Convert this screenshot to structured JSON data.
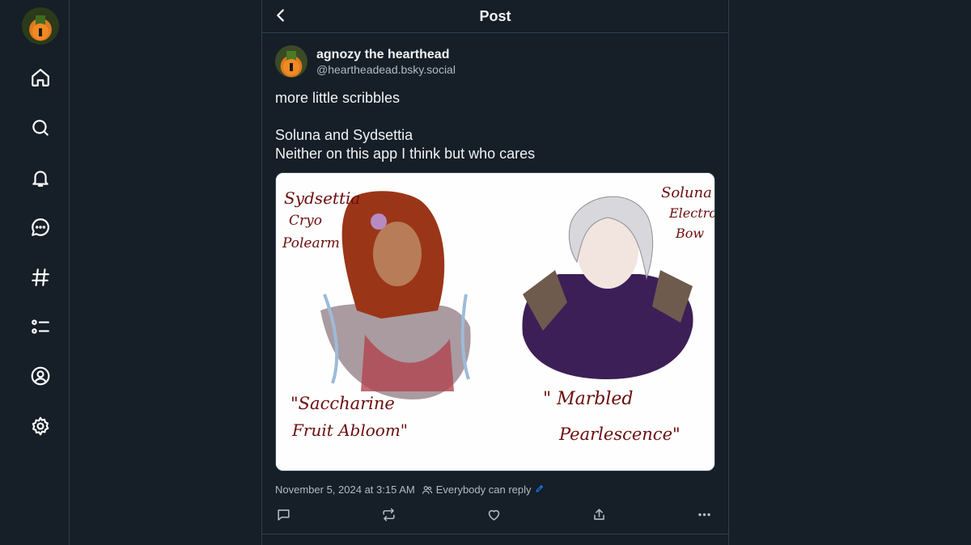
{
  "header": {
    "title": "Post"
  },
  "nav": {
    "items": [
      "home-icon",
      "search-icon",
      "bell-icon",
      "chat-icon",
      "hashtag-icon",
      "list-icon",
      "profile-icon",
      "gear-icon"
    ]
  },
  "post": {
    "display_name": "agnozy the hearthead",
    "handle": "@heartheadead.bsky.social",
    "text_lines": [
      "more little scribbles",
      "",
      "Soluna and Sydsettia",
      "Neither on this app I think but who cares"
    ],
    "image": {
      "left_label": [
        "Sydsettia",
        "Cryo",
        "Polearm"
      ],
      "right_label": [
        "Soluna",
        "Electro",
        "Bow"
      ],
      "left_caption": [
        "\"Saccharine",
        "Fruit Abloom\""
      ],
      "right_caption": [
        "\" Marbled",
        "Pearlescence\""
      ]
    },
    "timestamp": "November 5, 2024 at 3:15 AM",
    "reply_setting": "Everybody can reply"
  },
  "colors": {
    "background": "#161e27",
    "border": "#2e4052",
    "muted": "#aebbc9",
    "accent": "#1083fe"
  }
}
